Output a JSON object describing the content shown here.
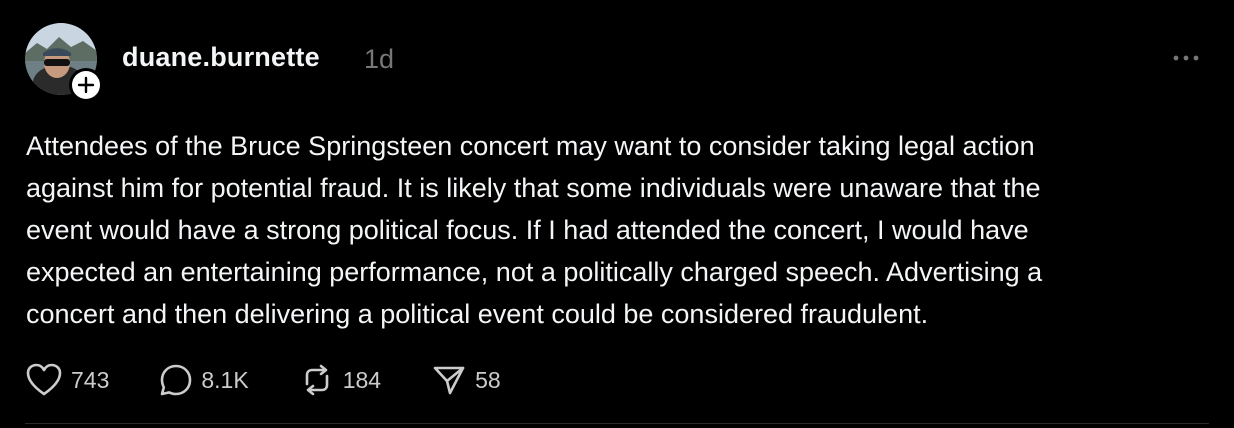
{
  "post": {
    "author": {
      "username": "duane.burnette",
      "avatar_icon": "profile-photo",
      "follow_icon": "plus-icon"
    },
    "timestamp": "1d",
    "more_icon": "ellipsis-icon",
    "text": "Attendees of the Bruce Springsteen concert may want to consider taking legal action\nagainst him for potential fraud. It is likely that some individuals were unaware that the\nevent would have a strong political focus. If I had attended the concert, I would have\nexpected an entertaining performance, not a politically charged speech. Advertising a\nconcert and then delivering a political event could be considered fraudulent.",
    "actions": {
      "likes": "743",
      "comments": "8.1K",
      "reposts": "184",
      "shares": "58"
    }
  },
  "colors": {
    "background": "#000000",
    "text": "#f3f5f7",
    "muted": "#777777"
  }
}
